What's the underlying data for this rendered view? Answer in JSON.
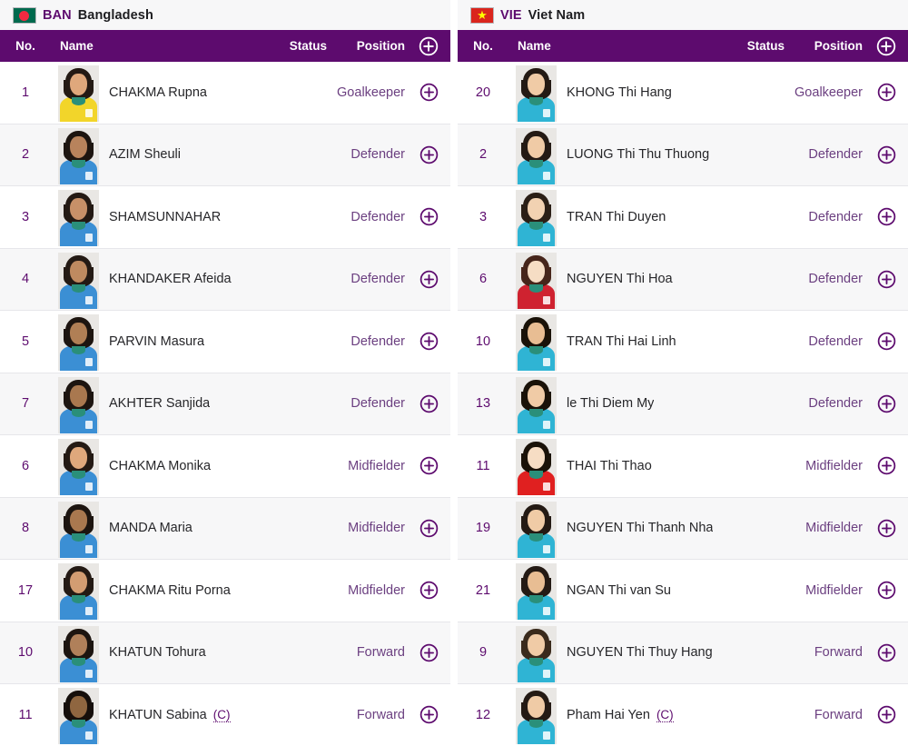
{
  "colors": {
    "header_purple": "#5d0b6e",
    "accent_purple": "#6b3f80",
    "row_alt": "#f7f7f8",
    "title_bg": "#f7f7f8",
    "text_dark": "#262629"
  },
  "columns": {
    "no": "No.",
    "name": "Name",
    "status": "Status",
    "position": "Position",
    "add_icon": "plus-circle-icon"
  },
  "teams": [
    {
      "code": "BAN",
      "name": "Bangladesh",
      "flag_icon": "bangladesh-flag-icon",
      "players": [
        {
          "no": "1",
          "name": "CHAKMA Rupna",
          "captain": "",
          "status": "",
          "position": "Goalkeeper",
          "kit": "#f2d52a",
          "hair": "#241a14",
          "skin": "#dfa87c"
        },
        {
          "no": "2",
          "name": "AZIM Sheuli",
          "captain": "",
          "status": "",
          "position": "Defender",
          "kit": "#3b8fd4",
          "hair": "#1d1510",
          "skin": "#b8835c"
        },
        {
          "no": "3",
          "name": "SHAMSUNNAHAR",
          "captain": "",
          "status": "",
          "position": "Defender",
          "kit": "#3b8fd4",
          "hair": "#241a14",
          "skin": "#c79068"
        },
        {
          "no": "4",
          "name": "KHANDAKER Afeida",
          "captain": "",
          "status": "",
          "position": "Defender",
          "kit": "#3b8fd4",
          "hair": "#241a14",
          "skin": "#bf8a60"
        },
        {
          "no": "5",
          "name": "PARVIN Masura",
          "captain": "",
          "status": "",
          "position": "Defender",
          "kit": "#3b8fd4",
          "hair": "#1d1510",
          "skin": "#b07f55"
        },
        {
          "no": "7",
          "name": "AKHTER Sanjida",
          "captain": "",
          "status": "",
          "position": "Defender",
          "kit": "#3b8fd4",
          "hair": "#1d1510",
          "skin": "#a9784f"
        },
        {
          "no": "6",
          "name": "CHAKMA Monika",
          "captain": "",
          "status": "",
          "position": "Midfielder",
          "kit": "#3b8fd4",
          "hair": "#241a14",
          "skin": "#dfa87c"
        },
        {
          "no": "8",
          "name": "MANDA Maria",
          "captain": "",
          "status": "",
          "position": "Midfielder",
          "kit": "#3b8fd4",
          "hair": "#1d1510",
          "skin": "#a9784f"
        },
        {
          "no": "17",
          "name": "CHAKMA Ritu Porna",
          "captain": "",
          "status": "",
          "position": "Midfielder",
          "kit": "#3b8fd4",
          "hair": "#241a14",
          "skin": "#d39d72"
        },
        {
          "no": "10",
          "name": "KHATUN Tohura",
          "captain": "",
          "status": "",
          "position": "Forward",
          "kit": "#3b8fd4",
          "hair": "#1d1510",
          "skin": "#b0805a"
        },
        {
          "no": "11",
          "name": "KHATUN Sabina",
          "captain": "(C)",
          "status": "",
          "position": "Forward",
          "kit": "#3b8fd4",
          "hair": "#160f0b",
          "skin": "#8f6640"
        }
      ]
    },
    {
      "code": "VIE",
      "name": "Viet Nam",
      "flag_icon": "vietnam-flag-icon",
      "players": [
        {
          "no": "20",
          "name": "KHONG Thi Hang",
          "captain": "",
          "status": "",
          "position": "Goalkeeper",
          "kit": "#2fb4d4",
          "hair": "#241a14",
          "skin": "#f0cba6"
        },
        {
          "no": "2",
          "name": "LUONG Thi Thu Thuong",
          "captain": "",
          "status": "",
          "position": "Defender",
          "kit": "#2fb4d4",
          "hair": "#241a14",
          "skin": "#f0cba6"
        },
        {
          "no": "3",
          "name": "TRAN Thi Duyen",
          "captain": "",
          "status": "",
          "position": "Defender",
          "kit": "#2fb4d4",
          "hair": "#2b1f16",
          "skin": "#f2d2b2"
        },
        {
          "no": "6",
          "name": "NGUYEN Thi Hoa",
          "captain": "",
          "status": "",
          "position": "Defender",
          "kit": "#cf2230",
          "hair": "#46251a",
          "skin": "#f6ddc4"
        },
        {
          "no": "10",
          "name": "TRAN Thi Hai Linh",
          "captain": "",
          "status": "",
          "position": "Defender",
          "kit": "#2fb4d4",
          "hair": "#1a1208",
          "skin": "#e8bd93"
        },
        {
          "no": "13",
          "name": "le Thi Diem My",
          "captain": "",
          "status": "",
          "position": "Defender",
          "kit": "#2fb4d4",
          "hair": "#1a1208",
          "skin": "#f0cba6"
        },
        {
          "no": "11",
          "name": "THAI Thi Thao",
          "captain": "",
          "status": "",
          "position": "Midfielder",
          "kit": "#e02020",
          "hair": "#1a1208",
          "skin": "#f6ddc4"
        },
        {
          "no": "19",
          "name": "NGUYEN Thi Thanh Nha",
          "captain": "",
          "status": "",
          "position": "Midfielder",
          "kit": "#2fb4d4",
          "hair": "#241a14",
          "skin": "#f0cba6"
        },
        {
          "no": "21",
          "name": "NGAN Thi van Su",
          "captain": "",
          "status": "",
          "position": "Midfielder",
          "kit": "#2fb4d4",
          "hair": "#241a14",
          "skin": "#e8bd93"
        },
        {
          "no": "9",
          "name": "NGUYEN Thi Thuy Hang",
          "captain": "",
          "status": "",
          "position": "Forward",
          "kit": "#2fb4d4",
          "hair": "#3a2a1c",
          "skin": "#f0cba6"
        },
        {
          "no": "12",
          "name": "Pham Hai Yen",
          "captain": "(C)",
          "status": "",
          "position": "Forward",
          "kit": "#2fb4d4",
          "hair": "#241a14",
          "skin": "#f0cba6"
        }
      ]
    }
  ]
}
